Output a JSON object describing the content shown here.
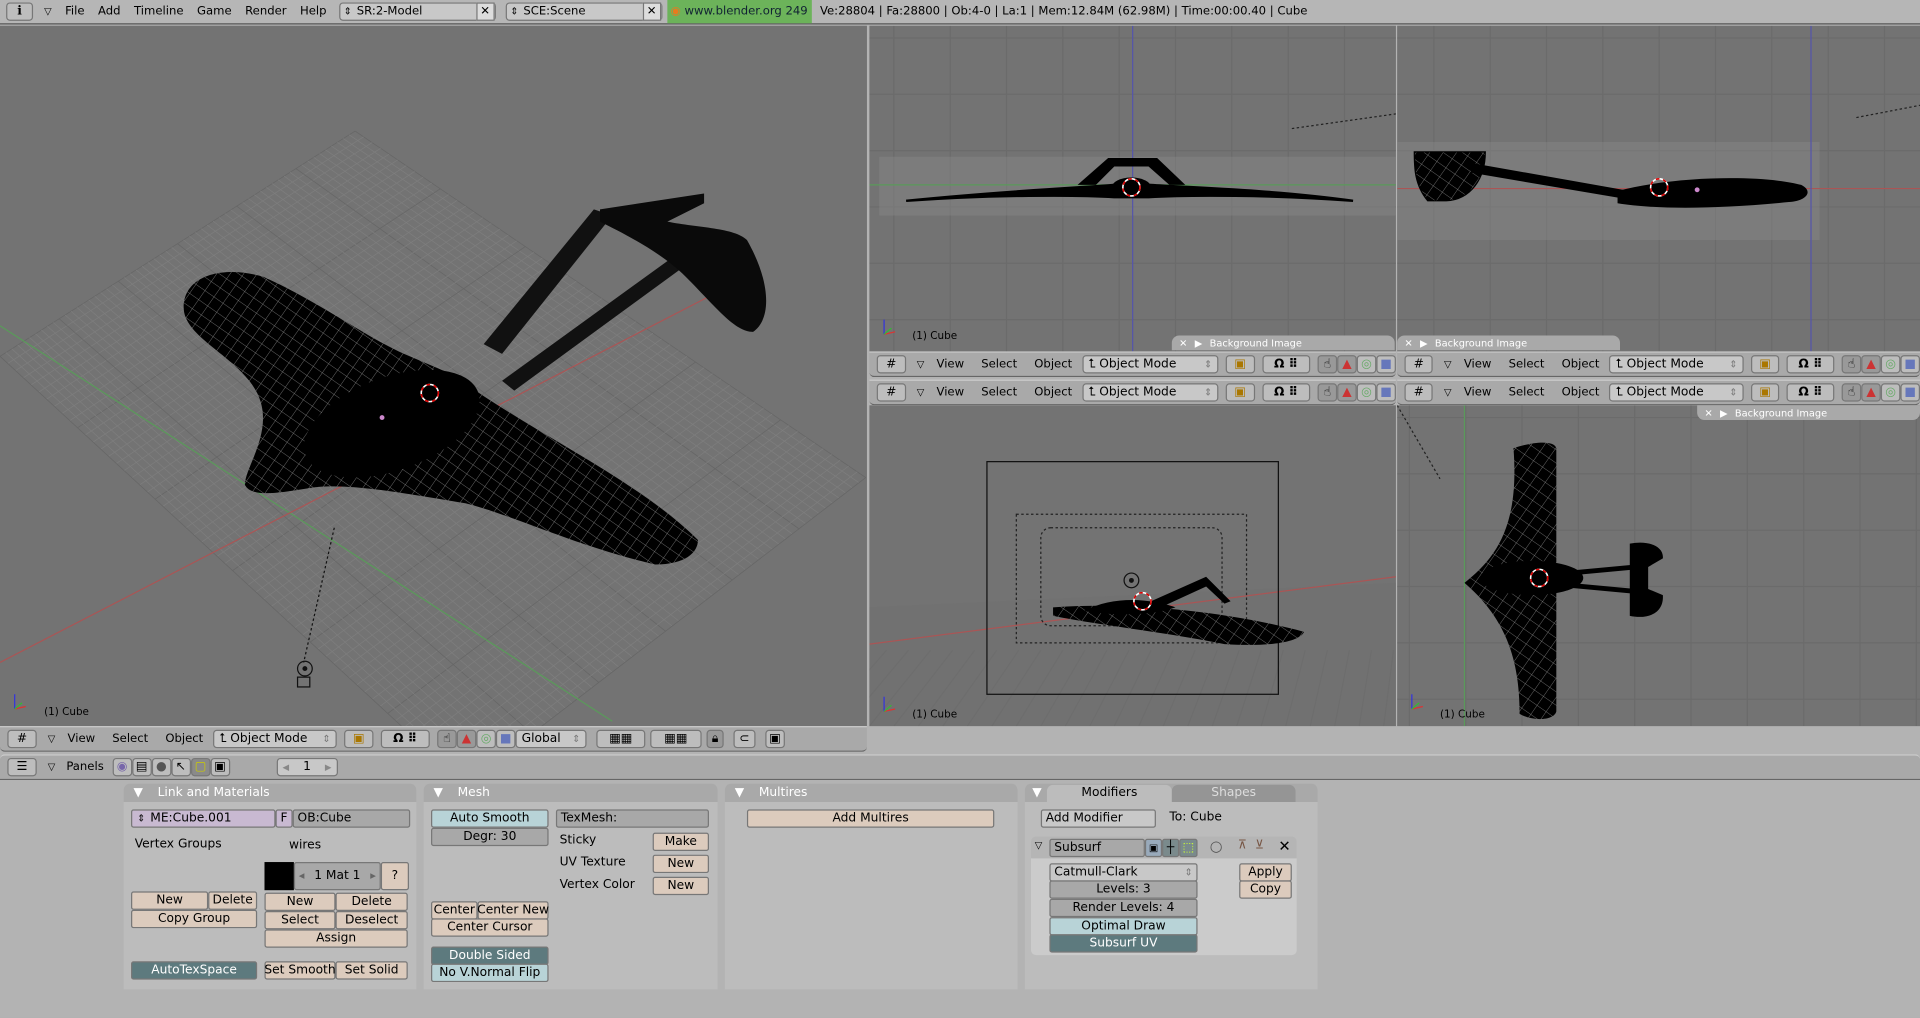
{
  "topbar": {
    "menus": [
      "File",
      "Add",
      "Timeline",
      "Game",
      "Render",
      "Help"
    ],
    "screen": "SR:2-Model",
    "scene": "SCE:Scene",
    "website": "www.blender.org 249",
    "stats": "Ve:28804 | Fa:28800 | Ob:4-0 | La:1  | Mem:12.84M (62.98M)  | Time:00:00.40 | Cube"
  },
  "view_header": {
    "menus": [
      "View",
      "Select",
      "Object"
    ],
    "mode": "Object Mode",
    "orientation": "Global"
  },
  "viewports": {
    "object_label": "(1) Cube",
    "background_image": "Background Image"
  },
  "buttons_header": {
    "panels_label": "Panels",
    "frame": "1"
  },
  "link_materials": {
    "title": "Link and Materials",
    "mesh_name": "ME:Cube.001",
    "f": "F",
    "object_name": "OB:Cube",
    "vertex_groups": "Vertex Groups",
    "material_name": "wires",
    "mat_field": "1 Mat 1",
    "help": "?",
    "vg_new": "New",
    "vg_delete": "Delete",
    "copy_group": "Copy Group",
    "m_new": "New",
    "m_delete": "Delete",
    "m_select": "Select",
    "m_deselect": "Deselect",
    "assign": "Assign",
    "autotexspace": "AutoTexSpace",
    "set_smooth": "Set Smooth",
    "set_solid": "Set Solid"
  },
  "mesh": {
    "title": "Mesh",
    "auto_smooth": "Auto Smooth",
    "degr": "Degr: 30",
    "texmesh": "TexMesh:",
    "sticky": "Sticky",
    "make": "Make",
    "uv_texture": "UV Texture",
    "uv_new": "New",
    "vertex_color": "Vertex Color",
    "vc_new": "New",
    "center": "Center",
    "center_new": "Center New",
    "center_cursor": "Center Cursor",
    "double_sided": "Double Sided",
    "no_vnormal_flip": "No V.Normal Flip"
  },
  "multires": {
    "title": "Multires",
    "add": "Add Multires"
  },
  "modifiers": {
    "tab_modifiers": "Modifiers",
    "tab_shapes": "Shapes",
    "add_modifier": "Add Modifier",
    "to": "To: Cube",
    "name": "Subsurf",
    "type": "Catmull-Clark",
    "levels": "Levels: 3",
    "render_levels": "Render Levels: 4",
    "optimal_draw": "Optimal Draw",
    "subsurf_uv": "Subsurf UV",
    "apply": "Apply",
    "copy": "Copy"
  },
  "colors": {
    "viewport": "#737373",
    "button": "#dccbbd",
    "toggle_on": "#5d7a7e",
    "toggle_off": "#b8d3d7",
    "mesh_field": "#c8b9d1",
    "website": "#6cb35a"
  }
}
